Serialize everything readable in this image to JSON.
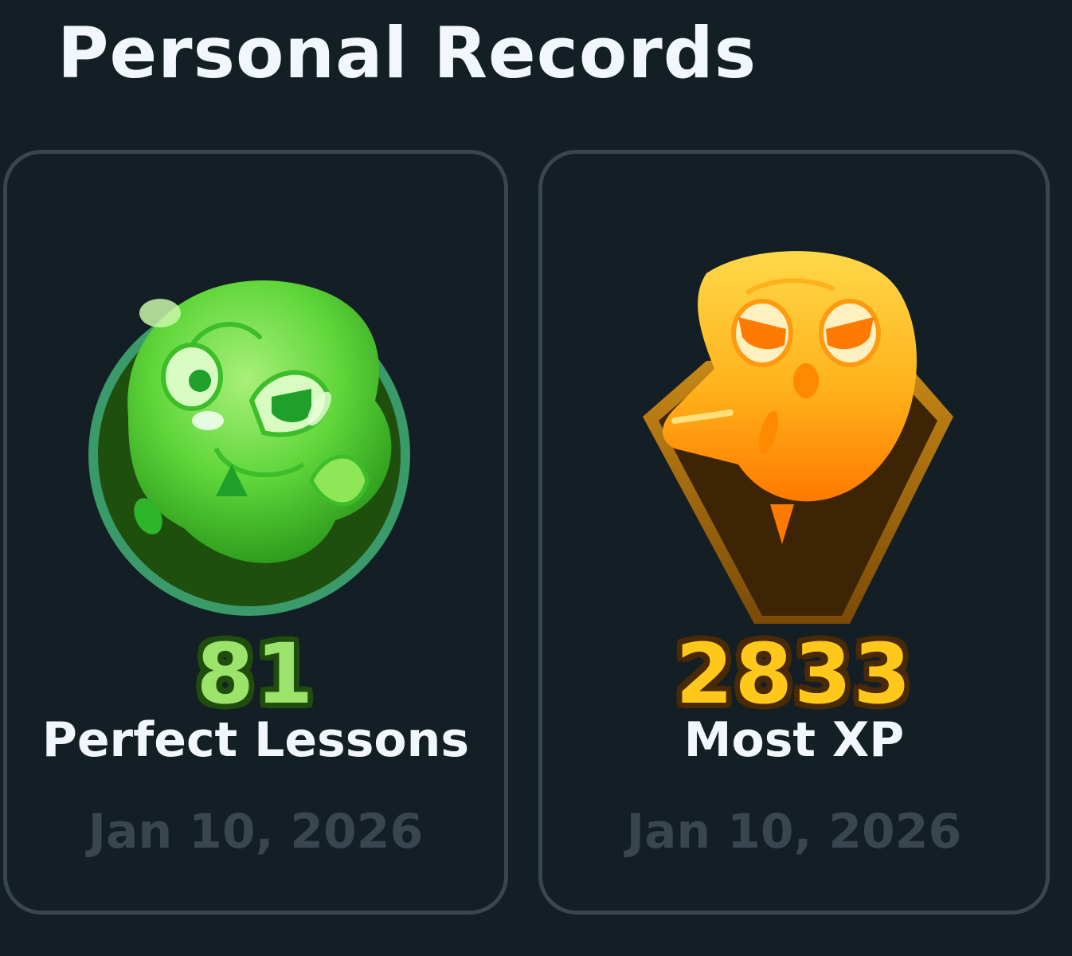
{
  "page": {
    "title": "Personal Records"
  },
  "records": [
    {
      "value": "81",
      "label": "Perfect Lessons",
      "date": "Jan 10, 2026",
      "badge_icon": "green-owl-badge-icon",
      "accent": "#9be36b"
    },
    {
      "value": "2833",
      "label": "Most XP",
      "date": "Jan 10, 2026",
      "badge_icon": "gold-owl-badge-icon",
      "accent": "#ffc81a"
    }
  ],
  "colors": {
    "background": "#131f24",
    "card_border": "#37464f",
    "title_text": "#f1f7fb",
    "date_text": "#37464f"
  }
}
